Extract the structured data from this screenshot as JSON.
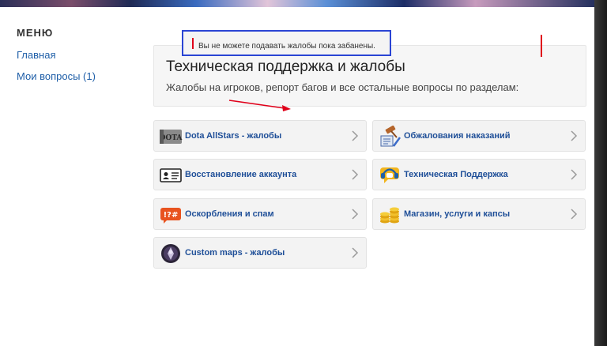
{
  "sidebar": {
    "title": "МЕНЮ",
    "items": [
      {
        "label": "Главная"
      },
      {
        "label": "Мои вопросы (1)"
      }
    ]
  },
  "notice": {
    "text": "Вы не можете подавать жалобы пока забанены."
  },
  "header": {
    "title": "Техническая поддержка и жалобы",
    "subtitle": "Жалобы на игроков, репорт багов и все остальные вопросы по разделам:"
  },
  "categories": [
    {
      "label": "Dota AllStars - жалобы",
      "icon": "dota-logo-icon"
    },
    {
      "label": "Обжалования наказаний",
      "icon": "gavel-icon"
    },
    {
      "label": "Восстановление аккаунта",
      "icon": "id-card-icon"
    },
    {
      "label": "Техническая Поддержка",
      "icon": "headset-icon"
    },
    {
      "label": "Оскорбления и спам",
      "icon": "swear-icon"
    },
    {
      "label": "Магазин, услуги и капсы",
      "icon": "coins-icon"
    },
    {
      "label": "Custom maps - жалобы",
      "icon": "custom-maps-icon"
    }
  ],
  "colors": {
    "link": "#1f5fa8",
    "tile_label": "#1f4f98",
    "annotation_red": "#e0001a",
    "annotation_blue": "#2a44d4"
  }
}
